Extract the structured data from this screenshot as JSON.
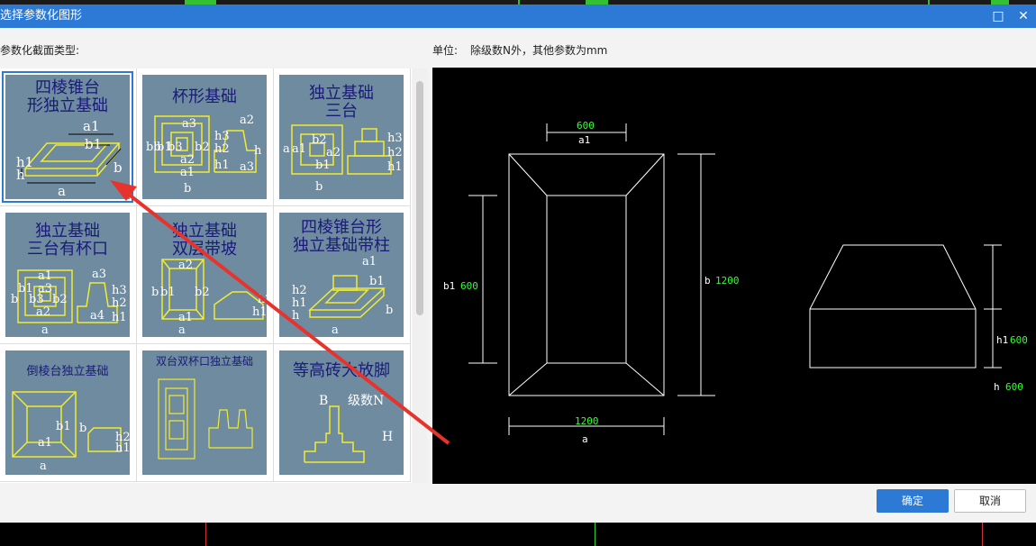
{
  "window": {
    "title": "选择参数化图形",
    "maximize_icon": "maximize-icon",
    "close_icon": "close-icon"
  },
  "left_label": "参数化截面类型:",
  "unit_label": "单位:",
  "unit_text": "除级数N外，其他参数为mm",
  "shapes": [
    {
      "title_lines": [
        "四棱锥台",
        "形独立基础"
      ],
      "labels": [
        "a1",
        "b1",
        "h1",
        "h",
        "b",
        "a"
      ]
    },
    {
      "title_lines": [
        "杯形基础"
      ],
      "labels": [
        "a2",
        "a3",
        "b3",
        "b2",
        "bb",
        "b1",
        "a2",
        "a1",
        "h3",
        "h2",
        "h1",
        "h",
        "a3",
        "b"
      ]
    },
    {
      "title_lines": [
        "独立基础",
        "三台"
      ],
      "labels": [
        "a",
        "a1",
        "b2",
        "a2",
        "b1",
        "h3",
        "h2",
        "h1",
        "b"
      ]
    },
    {
      "title_lines": [
        "独立基础",
        "三台有杯口"
      ],
      "labels": [
        "a1",
        "a3",
        "b1",
        "a3",
        "b",
        "b3",
        "b2",
        "a2",
        "h3",
        "h2",
        "h1",
        "a4",
        "a"
      ]
    },
    {
      "title_lines": [
        "独立基础",
        "双层带坡"
      ],
      "labels": [
        "a2",
        "b1",
        "b",
        "b2",
        "h2",
        "h1",
        "a1",
        "a"
      ]
    },
    {
      "title_lines": [
        "四棱锥台形",
        "独立基础带柱"
      ],
      "labels": [
        "a1",
        "b1",
        "h2",
        "h1",
        "h",
        "b",
        "a"
      ]
    },
    {
      "title_lines": [
        "倒棱台独立基础"
      ],
      "labels": [
        "b1",
        "b",
        "h2",
        "h1",
        "a1",
        "a"
      ]
    },
    {
      "title_lines": [
        "双台双杯口独立基础"
      ],
      "labels": []
    },
    {
      "title_lines": [
        "等高砖大放脚"
      ],
      "labels": [
        "B",
        "级数N",
        "H"
      ]
    }
  ],
  "preview": {
    "dims": [
      {
        "value": "600",
        "name": "a1"
      },
      {
        "value": "600",
        "name": "b1"
      },
      {
        "value": "1200",
        "name": "b"
      },
      {
        "value": "1200",
        "name": "a"
      },
      {
        "value": "600",
        "name": "h1"
      },
      {
        "value": "600",
        "name": "h"
      }
    ]
  },
  "buttons": {
    "ok": "确定",
    "cancel": "取消"
  },
  "colors": {
    "title_bar": "#2c7ad6",
    "thumb_bg": "#6e8ba0",
    "drawing_line": "#ffffff",
    "dim_value": "#33ff33",
    "arrow": "#e8322c",
    "selection": "#2c7ad6"
  }
}
